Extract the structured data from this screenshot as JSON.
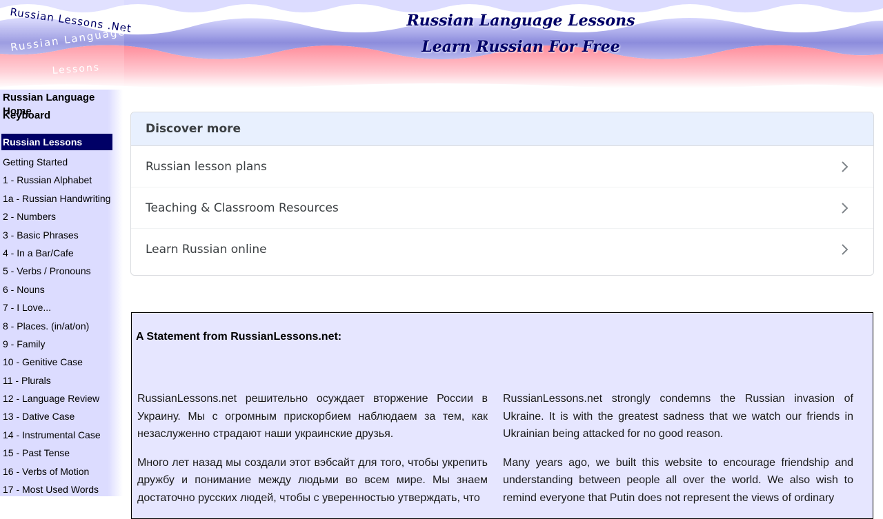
{
  "header": {
    "logo_line1": "Russian Lessons .Net",
    "logo_line2": "Russian Language",
    "logo_line3": "Lessons",
    "title": "Russian Language Lessons",
    "subtitle": "Learn Russian For Free"
  },
  "sidebar": {
    "top_links": [
      "Russian Language Home",
      "Keyboard"
    ],
    "section_title": "Russian Lessons",
    "items": [
      "Getting Started",
      "1 - Russian Alphabet",
      "1a - Russian Handwriting",
      "2 - Numbers",
      "3 - Basic Phrases",
      "4 - In a Bar/Cafe",
      "5 - Verbs / Pronouns",
      "6 - Nouns",
      "7 - I Love...",
      "8 - Places. (in/at/on)",
      "9 - Family",
      "10 - Genitive Case",
      "11 - Plurals",
      "12 - Language Review",
      "13 - Dative Case",
      "14 - Instrumental Case",
      "15 - Past Tense",
      "16 - Verbs of Motion",
      "17 - Most Used Words"
    ]
  },
  "discover": {
    "heading": "Discover more",
    "items": [
      "Russian lesson plans",
      "Teaching & Classroom Resources",
      "Learn Russian online"
    ],
    "chevron_icon": "chevron-right-icon"
  },
  "statement": {
    "title": "A Statement from RussianLessons.net:",
    "ru_p1": "RussianLessons.net решительно осуждает вторжение России в Украину. Мы с огромным прискорбием наблюдаем за тем, как незаслуженно страдают наши украинские друзья.",
    "ru_p2": "Много лет назад мы создали этот вэбсайт для того, чтобы укрепить дружбу и понимание между людьми во всем мире. Мы знаем достаточно русских людей, чтобы с уверенностью утверждать, что",
    "en_p1": "RussianLessons.net strongly condemns the Russian invasion of Ukraine. It is with the greatest sadness that we watch our friends in Ukrainian being attacked for no good reason.",
    "en_p2": "Many years ago, we built this website to encourage friendship and understanding between people all over the world. We also wish to remind everyone that Putin does not represent the views of ordinary"
  },
  "colors": {
    "navy": "#000066",
    "sidebar_bg": "#dcdcff",
    "statement_bg": "#e6e6ff",
    "wave_blue": "#8c8cdc",
    "wave_pink": "#ff9aa6"
  }
}
